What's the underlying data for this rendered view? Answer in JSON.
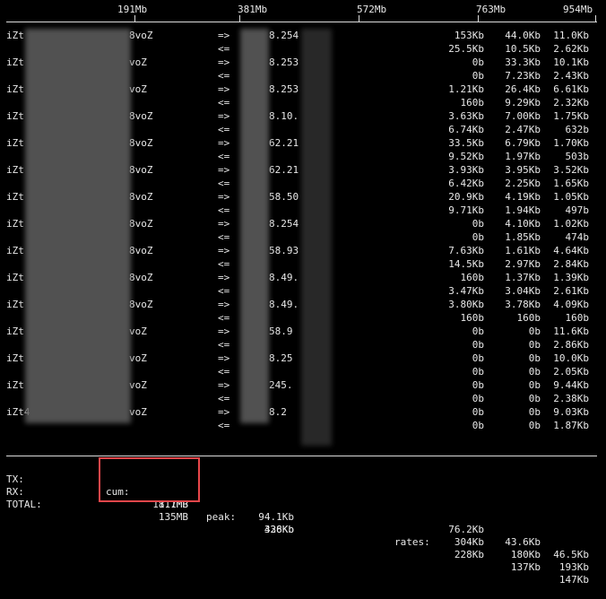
{
  "scale": {
    "ticks": [
      "191Mb",
      "381Mb",
      "572Mb",
      "763Mb",
      "954Mb"
    ]
  },
  "connections": [
    {
      "host": "iZt",
      "host_suffix": "8voZ",
      "peer": "8.254",
      "tx": [
        "153Kb",
        "44.0Kb",
        "11.0Kb"
      ],
      "rx": [
        "25.5Kb",
        "10.5Kb",
        "2.62Kb"
      ]
    },
    {
      "host": "iZt",
      "host_suffix": "voZ",
      "peer": "8.253",
      "tx": [
        "0b",
        "33.3Kb",
        "10.1Kb"
      ],
      "rx": [
        "0b",
        "7.23Kb",
        "2.43Kb"
      ]
    },
    {
      "host": "iZt",
      "host_suffix": "voZ",
      "peer": "8.253",
      "tx": [
        "1.21Kb",
        "26.4Kb",
        "6.61Kb"
      ],
      "rx": [
        "160b",
        "9.29Kb",
        "2.32Kb"
      ]
    },
    {
      "host": "iZt",
      "host_suffix": "8voZ",
      "peer": "8.10.",
      "tx": [
        "3.63Kb",
        "7.00Kb",
        "1.75Kb"
      ],
      "rx": [
        "6.74Kb",
        "2.47Kb",
        "632b"
      ]
    },
    {
      "host": "iZt",
      "host_suffix": "8voZ",
      "peer": "62.21",
      "tx": [
        "33.5Kb",
        "6.79Kb",
        "1.70Kb"
      ],
      "rx": [
        "9.52Kb",
        "1.97Kb",
        "503b"
      ]
    },
    {
      "host": "iZt",
      "host_suffix": "8voZ",
      "peer": "62.21",
      "tx": [
        "3.93Kb",
        "3.95Kb",
        "3.52Kb"
      ],
      "rx": [
        "6.42Kb",
        "2.25Kb",
        "1.65Kb"
      ]
    },
    {
      "host": "iZt",
      "host_suffix": "8voZ",
      "peer": "58.50",
      "tx": [
        "20.9Kb",
        "4.19Kb",
        "1.05Kb"
      ],
      "rx": [
        "9.71Kb",
        "1.94Kb",
        "497b"
      ]
    },
    {
      "host": "iZt",
      "host_suffix": "8voZ",
      "peer": "8.254",
      "tx": [
        "0b",
        "4.10Kb",
        "1.02Kb"
      ],
      "rx": [
        "0b",
        "1.85Kb",
        "474b"
      ]
    },
    {
      "host": "iZt",
      "host_suffix": "8voZ",
      "peer": "58.93",
      "tx": [
        "7.63Kb",
        "1.61Kb",
        "4.64Kb"
      ],
      "rx": [
        "14.5Kb",
        "2.97Kb",
        "2.84Kb"
      ]
    },
    {
      "host": "iZt",
      "host_suffix": "8voZ",
      "peer": "8.49.",
      "tx": [
        "160b",
        "1.37Kb",
        "1.39Kb"
      ],
      "rx": [
        "3.47Kb",
        "3.04Kb",
        "2.61Kb"
      ]
    },
    {
      "host": "iZt",
      "host_suffix": "8voZ",
      "peer": "8.49.",
      "tx": [
        "3.80Kb",
        "3.78Kb",
        "4.09Kb"
      ],
      "rx": [
        "160b",
        "160b",
        "160b"
      ]
    },
    {
      "host": "iZt",
      "host_suffix": "voZ",
      "peer": "58.9",
      "tx": [
        "0b",
        "0b",
        "11.6Kb"
      ],
      "rx": [
        "0b",
        "0b",
        "2.86Kb"
      ]
    },
    {
      "host": "iZt",
      "host_suffix": "voZ",
      "peer": "8.25",
      "tx": [
        "0b",
        "0b",
        "10.0Kb"
      ],
      "rx": [
        "0b",
        "0b",
        "2.05Kb"
      ]
    },
    {
      "host": "iZt",
      "host_suffix": "voZ",
      "peer": "245.",
      "tx": [
        "0b",
        "0b",
        "9.44Kb"
      ],
      "rx": [
        "0b",
        "0b",
        "2.38Kb"
      ]
    },
    {
      "host": "iZt4",
      "host_suffix": "voZ",
      "peer": "8.2",
      "tx": [
        "0b",
        "0b",
        "9.03Kb"
      ],
      "rx": [
        "0b",
        "0b",
        "1.87Kb"
      ]
    }
  ],
  "direction": {
    "tx": "=>",
    "rx": "<="
  },
  "totals": {
    "labels": {
      "tx": "TX:",
      "rx": "RX:",
      "total": "TOTAL:"
    },
    "cum_label": "cum:",
    "peak_label": "peak:",
    "rates_label": "rates:",
    "cum": {
      "tx": "117MB",
      "rx": "18.1MB",
      "total": "135MB"
    },
    "peak": {
      "tx": "338Kb",
      "rx": "94.1Kb",
      "total": "426Kb"
    },
    "rates": {
      "tx": [
        "228Kb",
        "137Kb",
        "147Kb"
      ],
      "rx": [
        "76.2Kb",
        "43.6Kb",
        "46.5Kb"
      ],
      "total": [
        "304Kb",
        "180Kb",
        "193Kb"
      ]
    }
  },
  "colors": {
    "background": "#000000",
    "text": "#e8e8e8",
    "highlight": "#e8464a"
  }
}
